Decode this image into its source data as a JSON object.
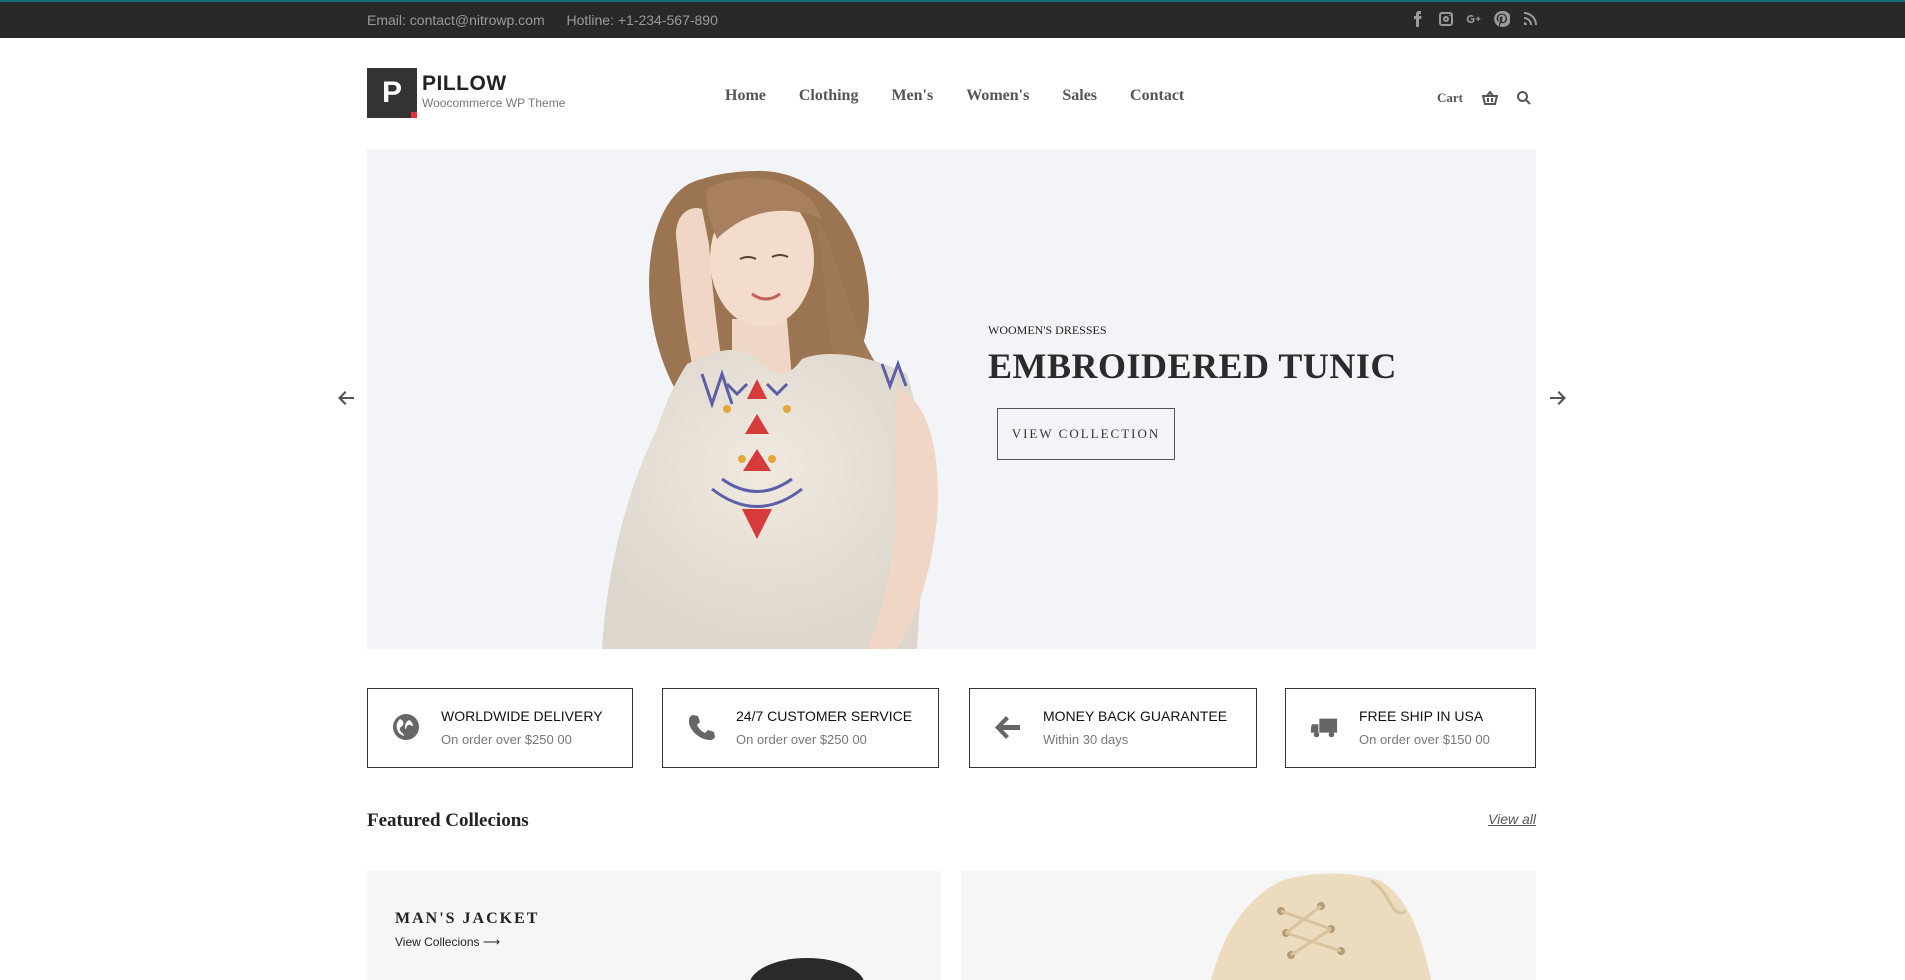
{
  "topbar": {
    "email": "Email: contact@nitrowp.com",
    "hotline": "Hotline: +1-234-567-890",
    "social": [
      "facebook-icon",
      "instagram-icon",
      "google-plus-icon",
      "pinterest-icon",
      "rss-icon"
    ]
  },
  "logo": {
    "letter": "P",
    "title": "PILLOW",
    "subtitle": "Woocommerce WP Theme"
  },
  "nav": [
    "Home",
    "Clothing",
    "Men's",
    "Women's",
    "Sales",
    "Contact"
  ],
  "cart": {
    "label": "Cart"
  },
  "hero": {
    "category": "WOOMEN'S DRESSES",
    "title": "EMBROIDERED TUNIC",
    "button": "VIEW COLLECTION"
  },
  "features": [
    {
      "icon": "globe-icon",
      "title": "WORLDWIDE DELIVERY",
      "subtitle": "On order over $250 00"
    },
    {
      "icon": "phone-icon",
      "title": "24/7 CUSTOMER SERVICE",
      "subtitle": "On order over $250 00"
    },
    {
      "icon": "arrow-left-icon",
      "title": "MONEY BACK GUARANTEE",
      "subtitle": "Within 30 days"
    },
    {
      "icon": "truck-icon",
      "title": "FREE SHIP IN USA",
      "subtitle": "On order over $150 00"
    }
  ],
  "featured": {
    "title": "Featured Collecions",
    "view_all": "View all",
    "cards": [
      {
        "title": "MAN'S JACKET",
        "link": "View Collecions ⟶"
      },
      {
        "title": "",
        "link": ""
      }
    ]
  }
}
